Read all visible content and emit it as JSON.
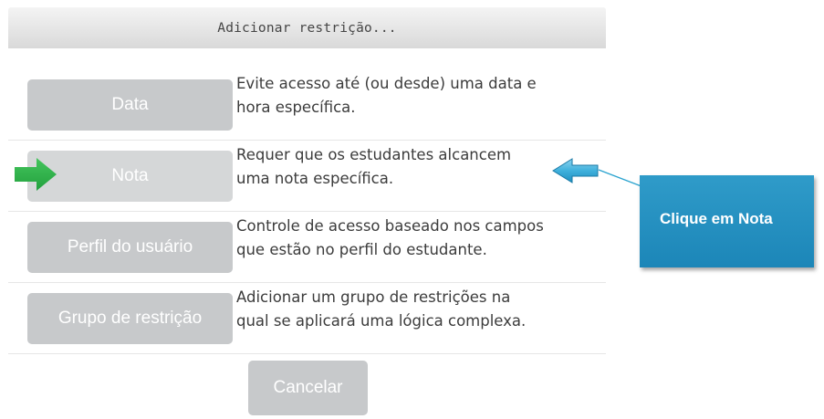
{
  "dialog": {
    "title": "Adicionar restrição...",
    "options": [
      {
        "button_label": "Data",
        "description_lines": [
          "Evite acesso até (ou desde) uma data e",
          "hora específica."
        ]
      },
      {
        "button_label": "Nota",
        "description_lines": [
          "Requer que os estudantes alcancem",
          "uma nota específica."
        ]
      },
      {
        "button_label": "Perfil do usuário",
        "description_lines": [
          "Controle de acesso baseado nos campos",
          "que estão no perfil do estudante."
        ]
      },
      {
        "button_label": "Grupo de restrição",
        "description_lines": [
          "Adicionar um grupo de restrições na",
          "qual se aplicará uma lógica complexa."
        ]
      }
    ],
    "cancel_label": "Cancelar"
  },
  "annotation": {
    "callout_text": "Clique em Nota",
    "callout_color": "#2493c2",
    "pointer_arrow_color": "#2aa3cf",
    "highlight_arrow_color": "#2fb34a"
  }
}
